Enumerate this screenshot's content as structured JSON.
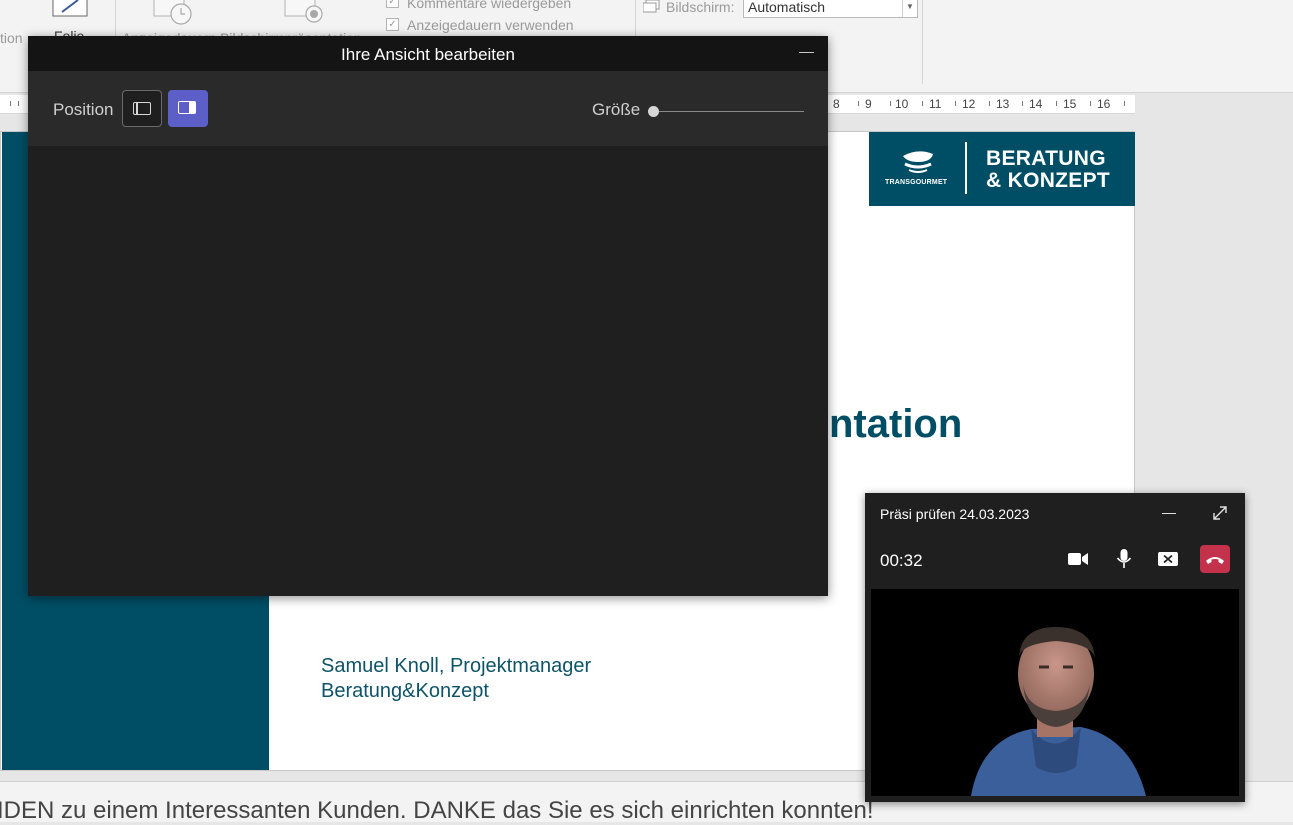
{
  "ribbon": {
    "cut_left_label": "tion",
    "folie_label": "Folie",
    "cut_bottom_labels": "Anzeigedauern Bildschirmpräsentation",
    "checkbox_comments": "Kommentare wiedergeben",
    "checkbox_timings": "Anzeigedauern verwenden",
    "screen_label": "Bildschirm:",
    "screen_value": "Automatisch"
  },
  "ruler": {
    "labels": [
      "8",
      "9",
      "10",
      "11",
      "12",
      "13",
      "14",
      "15",
      "16"
    ]
  },
  "slide": {
    "logo_brand": "TRANSGOURMET",
    "logo_line1": "BERATUNG",
    "logo_line2": "& KONZEPT",
    "title_visible_part": "ntation",
    "presenter_line": "Samuel Knoll, Projektmanager",
    "department_line": "Beratung&Konzept",
    "colors": {
      "band": "#004e65",
      "text": "#0e5468"
    }
  },
  "notes": {
    "text": "IDEN zu einem Interessanten Kunden. DANKE das Sie es sich einrichten konnten!"
  },
  "edit_view": {
    "title": "Ihre Ansicht bearbeiten",
    "position_label": "Position",
    "position_options": [
      "left-layout",
      "right-layout"
    ],
    "position_selected": "right-layout",
    "size_label": "Größe",
    "size_value": 0,
    "accent": "#5b5fc7"
  },
  "call": {
    "title": "Präsi prüfen 24.03.2023",
    "timer": "00:32",
    "controls": [
      "camera-icon",
      "microphone-icon",
      "stop-sharing-icon",
      "hang-up-icon"
    ],
    "hangup_color": "#c4314b"
  }
}
